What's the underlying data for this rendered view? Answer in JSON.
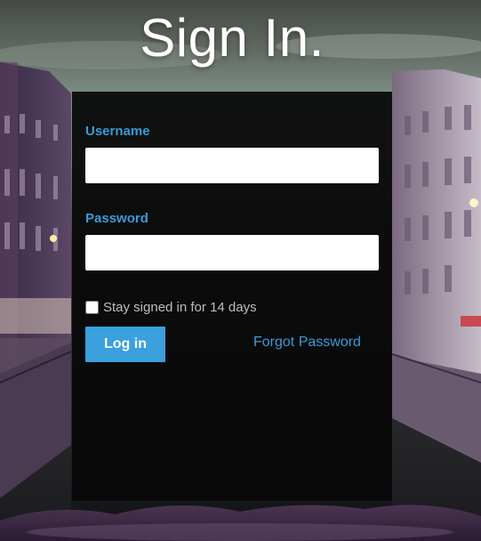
{
  "page": {
    "title": "Sign In."
  },
  "form": {
    "username_label": "Username",
    "username_value": "",
    "password_label": "Password",
    "password_value": "",
    "remember_label": "Stay signed in for 14 days",
    "remember_checked": false,
    "login_label": "Log in",
    "forgot_label": "Forgot Password"
  },
  "colors": {
    "accent": "#3a9bd9",
    "button": "#3aa0de",
    "panel": "#080808"
  }
}
